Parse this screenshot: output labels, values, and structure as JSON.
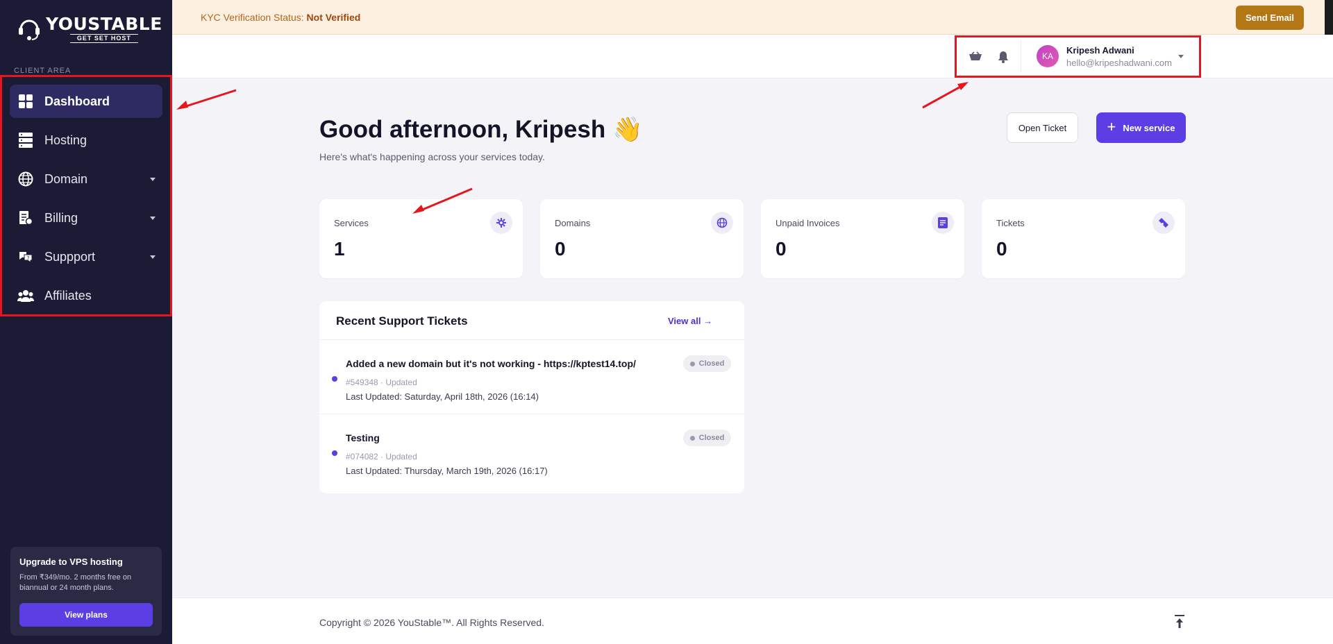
{
  "brand": {
    "name": "YOUSTABLE",
    "tagline": "GET SET HOST"
  },
  "sidebar": {
    "section_label": "CLIENT AREA",
    "items": [
      {
        "label": "Dashboard",
        "icon": "grid-icon",
        "active": true
      },
      {
        "label": "Hosting",
        "icon": "server-icon"
      },
      {
        "label": "Domain",
        "icon": "globe-icon",
        "has_submenu": true
      },
      {
        "label": "Billing",
        "icon": "invoice-icon",
        "has_submenu": true
      },
      {
        "label": "Suppport",
        "icon": "support-chat-icon",
        "has_submenu": true
      },
      {
        "label": "Affiliates",
        "icon": "users-icon"
      }
    ],
    "upgrade": {
      "title": "Upgrade to VPS hosting",
      "description": "From ₹349/mo. 2 months free on biannual or 24 month plans.",
      "button": "View plans"
    }
  },
  "kyc": {
    "label": "KYC Verification Status:",
    "status": "Not Verified",
    "button": "Send Email"
  },
  "topbar": {
    "user": {
      "initials": "KA",
      "name": "Kripesh Adwani",
      "email": "hello@kripeshadwani.com"
    }
  },
  "main": {
    "greeting": "Good afternoon, Kripesh 👋",
    "subtitle": "Here's what's happening across your services today.",
    "open_ticket": "Open Ticket",
    "new_service": "New service",
    "stats": [
      {
        "label": "Services",
        "value": "1",
        "icon": "services-icon"
      },
      {
        "label": "Domains",
        "value": "0",
        "icon": "globe-icon"
      },
      {
        "label": "Unpaid Invoices",
        "value": "0",
        "icon": "document-icon"
      },
      {
        "label": "Tickets",
        "value": "0",
        "icon": "ticket-icon"
      }
    ],
    "tickets": {
      "title": "Recent Support Tickets",
      "view_all": "View all →",
      "items": [
        {
          "subject": "Added a new domain but it's not working - https://kptest14.top/",
          "meta": "#549348 · Updated",
          "updated": "Last Updated: Saturday, April 18th, 2026 (16:14)",
          "status": "Closed"
        },
        {
          "subject": "Testing",
          "meta": "#074082 · Updated",
          "updated": "Last Updated: Thursday, March 19th, 2026 (16:17)",
          "status": "Closed"
        }
      ]
    }
  },
  "footer": {
    "copyright": "Copyright © 2026 YouStable™. All Rights Reserved."
  },
  "colors": {
    "sidebar": "#1b1b36",
    "accent": "#5b3fe4",
    "kyc_button": "#b47716",
    "annotation": "#e5161d"
  }
}
